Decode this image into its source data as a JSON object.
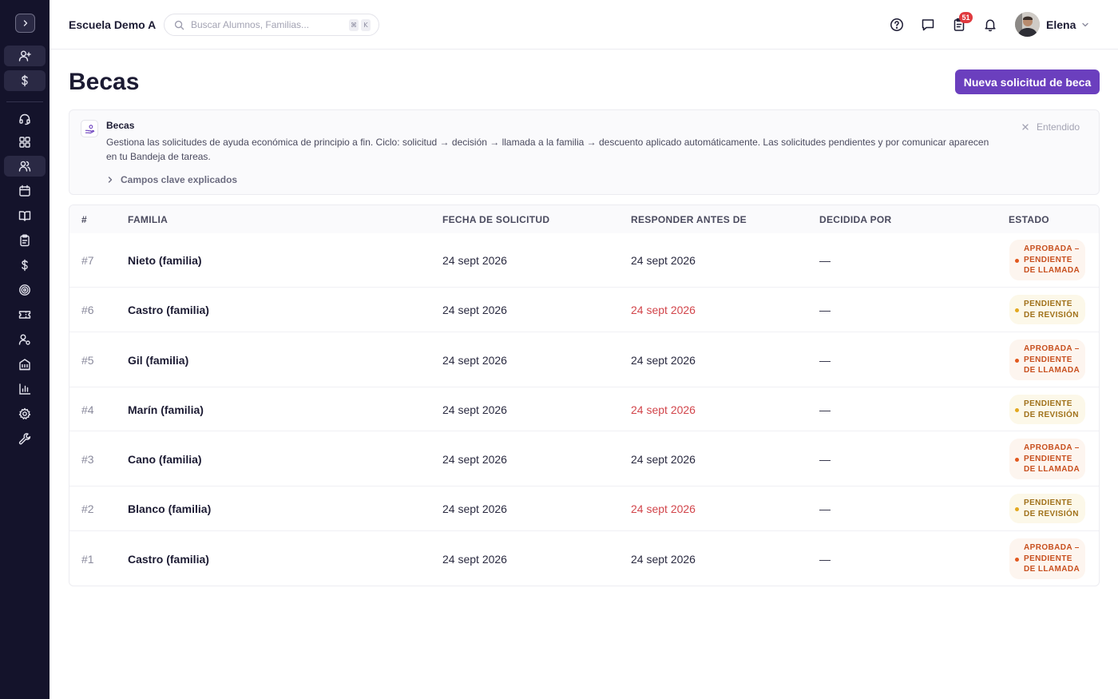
{
  "header": {
    "school": "Escuela Demo A",
    "search_placeholder": "Buscar Alumnos, Familias...",
    "shortcut_keys": [
      "⌘",
      "K"
    ],
    "task_badge": "51",
    "user_name": "Elena"
  },
  "sidebar": {
    "items": [
      {
        "icon": "add-user-icon"
      },
      {
        "icon": "dollar-icon"
      },
      {
        "icon": "headset-icon"
      },
      {
        "icon": "grid-icon"
      },
      {
        "icon": "users-icon"
      },
      {
        "icon": "calendar-icon"
      },
      {
        "icon": "book-icon"
      },
      {
        "icon": "clipboard-icon"
      },
      {
        "icon": "dollar-icon"
      },
      {
        "icon": "target-icon"
      },
      {
        "icon": "ticket-icon"
      },
      {
        "icon": "user-settings-icon"
      },
      {
        "icon": "building-icon"
      },
      {
        "icon": "bar-chart-icon"
      },
      {
        "icon": "gear-icon"
      },
      {
        "icon": "wrench-icon"
      }
    ]
  },
  "page": {
    "title": "Becas",
    "new_button": "Nueva solicitud de beca"
  },
  "info": {
    "title": "Becas",
    "text": "Gestiona las solicitudes de ayuda económica de principio a fin. Ciclo: solicitud → decisión → llamada a la familia → descuento aplicado automáticamente. Las solicitudes pendientes y por comunicar aparecen en tu Bandeja de tareas.",
    "link": "Campos clave explicados",
    "dismiss": "Entendido"
  },
  "table": {
    "columns": [
      "#",
      "FAMILIA",
      "FECHA DE SOLICITUD",
      "RESPONDER ANTES DE",
      "DECIDIDA POR",
      "ESTADO"
    ],
    "rows": [
      {
        "num": "#7",
        "family": "Nieto (familia)",
        "requested": "24 sept 2026",
        "respond_by": "24 sept 2026",
        "respond_late": false,
        "decided_by": "—",
        "status": "APROBADA – PENDIENTE DE LLAMADA",
        "status_type": "approved"
      },
      {
        "num": "#6",
        "family": "Castro (familia)",
        "requested": "24 sept 2026",
        "respond_by": "24 sept 2026",
        "respond_late": true,
        "decided_by": "—",
        "status": "PENDIENTE DE REVISIÓN",
        "status_type": "pending"
      },
      {
        "num": "#5",
        "family": "Gil (familia)",
        "requested": "24 sept 2026",
        "respond_by": "24 sept 2026",
        "respond_late": false,
        "decided_by": "—",
        "status": "APROBADA – PENDIENTE DE LLAMADA",
        "status_type": "approved"
      },
      {
        "num": "#4",
        "family": "Marín (familia)",
        "requested": "24 sept 2026",
        "respond_by": "24 sept 2026",
        "respond_late": true,
        "decided_by": "—",
        "status": "PENDIENTE DE REVISIÓN",
        "status_type": "pending"
      },
      {
        "num": "#3",
        "family": "Cano (familia)",
        "requested": "24 sept 2026",
        "respond_by": "24 sept 2026",
        "respond_late": false,
        "decided_by": "—",
        "status": "APROBADA – PENDIENTE DE LLAMADA",
        "status_type": "approved"
      },
      {
        "num": "#2",
        "family": "Blanco (familia)",
        "requested": "24 sept 2026",
        "respond_by": "24 sept 2026",
        "respond_late": true,
        "decided_by": "—",
        "status": "PENDIENTE DE REVISIÓN",
        "status_type": "pending"
      },
      {
        "num": "#1",
        "family": "Castro (familia)",
        "requested": "24 sept 2026",
        "respond_by": "24 sept 2026",
        "respond_late": false,
        "decided_by": "—",
        "status": "APROBADA – PENDIENTE DE LLAMADA",
        "status_type": "approved"
      }
    ]
  },
  "colors": {
    "sidebar_bg": "#14132b",
    "primary": "#6b3fbe",
    "late": "#d2454b",
    "approved": "#c8501f",
    "pending": "#a0711a",
    "badge": "#e0393e"
  }
}
